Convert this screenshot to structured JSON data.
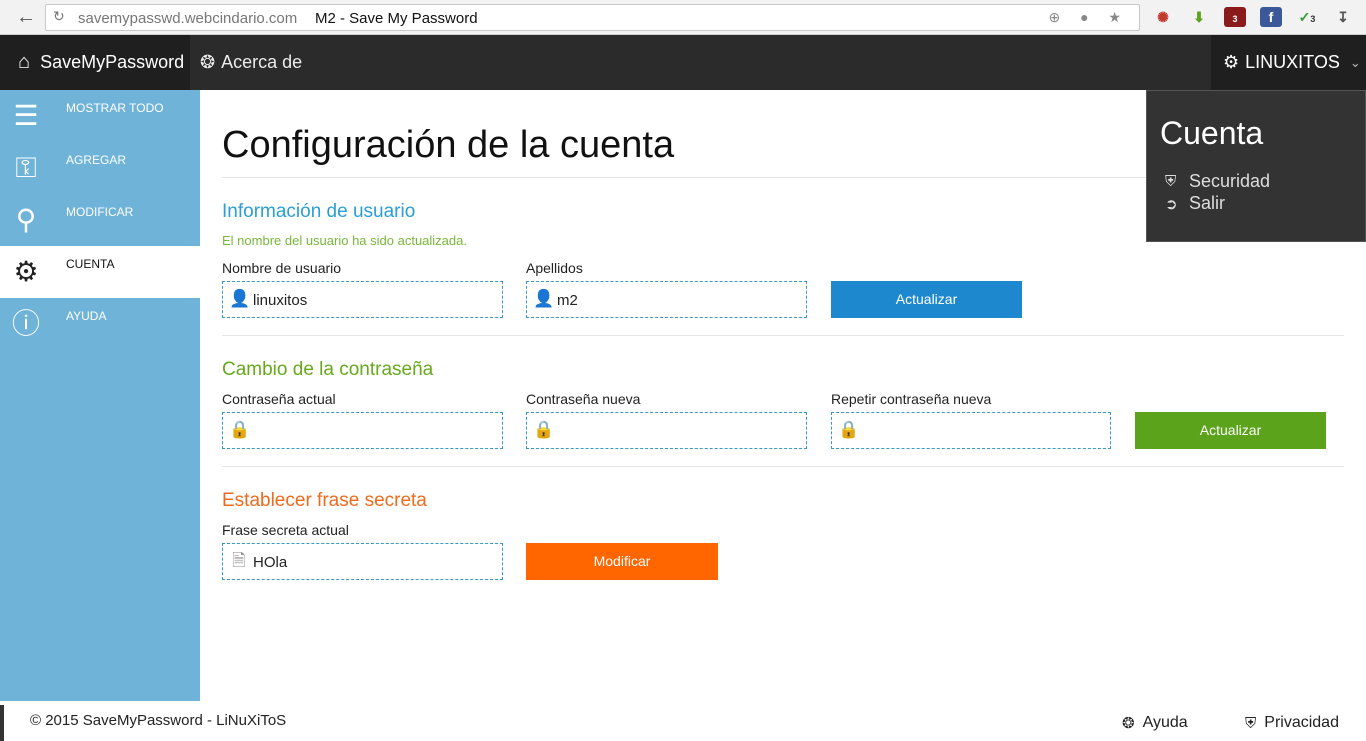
{
  "browser": {
    "url_host": "savemypasswd.webcindario.com",
    "page_title": "M2 - Save My Password",
    "extension_badges": [
      "3",
      "3"
    ]
  },
  "navbar": {
    "brand": "SaveMyPassword",
    "about": "Acerca de",
    "user": "LINUXITOS"
  },
  "dropdown": {
    "title": "Cuenta",
    "items": [
      "Securidad",
      "Salir"
    ]
  },
  "sidebar": {
    "items": [
      {
        "label": "MOSTRAR TODO",
        "icon": "list-icon"
      },
      {
        "label": "AGREGAR",
        "icon": "key-icon"
      },
      {
        "label": "MODIFICAR",
        "icon": "search-icon"
      },
      {
        "label": "CUENTA",
        "icon": "gears-icon"
      },
      {
        "label": "AYUDA",
        "icon": "info-icon"
      }
    ],
    "active_index": 3
  },
  "main": {
    "title": "Configuración de la cuenta",
    "user_info": {
      "title": "Información de usuario",
      "message": "El nombre del usuario ha sido actualizada.",
      "username_label": "Nombre de usuario",
      "username_value": "linuxitos",
      "surname_label": "Apellidos",
      "surname_value": "m2",
      "button": "Actualizar"
    },
    "password": {
      "title": "Cambio de la contraseña",
      "current_label": "Contraseña actual",
      "new_label": "Contraseña nueva",
      "repeat_label": "Repetir contraseña nueva",
      "button": "Actualizar"
    },
    "secret": {
      "title": "Establecer frase secreta",
      "current_label": "Frase secreta actual",
      "current_value": "HOla",
      "button": "Modificar"
    }
  },
  "footer": {
    "copyright": "© 2015 SaveMyPassword - LiNuXiToS",
    "help": "Ayuda",
    "privacy": "Privacidad"
  },
  "colors": {
    "sidebar": "#6fb3d8",
    "navbar": "#2b2b2b",
    "blue": "#2a9fd6",
    "green": "#5aa31b",
    "orange": "#ff6600"
  }
}
